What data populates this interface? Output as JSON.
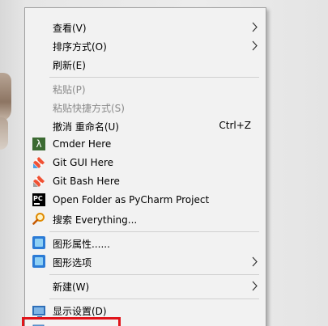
{
  "menu": {
    "items": [
      {
        "label": "查看(V)",
        "submenu": true,
        "icon": null
      },
      {
        "label": "排序方式(O)",
        "submenu": true,
        "icon": null
      },
      {
        "label": "刷新(E)",
        "icon": null
      },
      {
        "label": "粘贴(P)",
        "disabled": true,
        "icon": null
      },
      {
        "label": "粘贴快捷方式(S)",
        "disabled": true,
        "icon": null
      },
      {
        "label": "撤消 重命名(U)",
        "shortcut": "Ctrl+Z",
        "icon": null
      },
      {
        "label": "Cmder Here",
        "icon": "cmder-icon"
      },
      {
        "label": "Git GUI Here",
        "icon": "git-gui-icon"
      },
      {
        "label": "Git Bash Here",
        "icon": "git-bash-icon"
      },
      {
        "label": "Open Folder as PyCharm Project",
        "icon": "pycharm-icon"
      },
      {
        "label": "搜索 Everything...",
        "icon": "everything-search-icon"
      },
      {
        "label": "图形属性......",
        "icon": "graphics-properties-icon"
      },
      {
        "label": "图形选项",
        "submenu": true,
        "icon": "graphics-options-icon"
      },
      {
        "label": "新建(W)",
        "submenu": true,
        "icon": null
      },
      {
        "label": "显示设置(D)",
        "icon": "display-icon"
      }
    ]
  },
  "icon_glyphs": {
    "lambda": "λ",
    "pycharm": "PC"
  },
  "colors": {
    "highlight_border": "#e0141a",
    "menu_background": "#f2f2f2",
    "disabled_text": "#8a8a8a"
  }
}
